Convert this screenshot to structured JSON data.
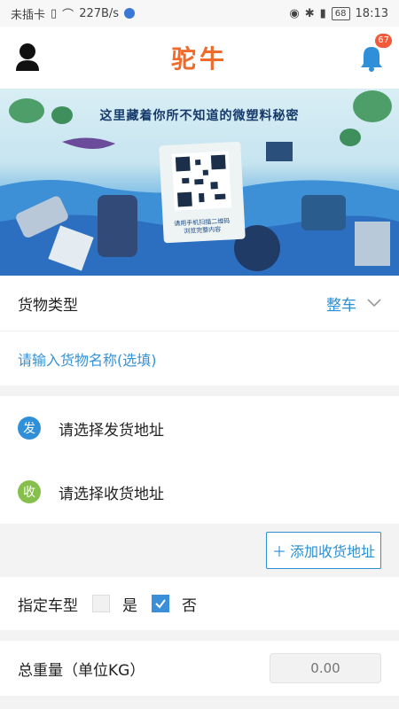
{
  "status_bar": {
    "carrier": "未插卡",
    "speed": "227B/s",
    "battery": "68",
    "time": "18:13"
  },
  "header": {
    "title": "驼牛",
    "notification_count": "67",
    "brand_color": "#f06a2a"
  },
  "banner": {
    "headline": "这里藏着你所不知道的微塑料秘密",
    "qr_caption": "请用手机扫描二维码\n浏览完整内容"
  },
  "cargo": {
    "type_label": "货物类型",
    "type_value": "整车",
    "name_placeholder": "请输入货物名称(选填)"
  },
  "address": {
    "send_icon": "发",
    "send_label": "请选择发货地址",
    "recv_icon": "收",
    "recv_label": "请选择收货地址",
    "add_button": "添加收货地址"
  },
  "vehicle": {
    "label": "指定车型",
    "option_yes": "是",
    "option_no": "否",
    "selected": "否"
  },
  "weight": {
    "label": "总重量（单位KG）",
    "placeholder": "0.00"
  },
  "colors": {
    "accent": "#2a8fd3",
    "send": "#2f8fd9",
    "recv": "#86bf4b",
    "badge": "#f25a3c"
  }
}
